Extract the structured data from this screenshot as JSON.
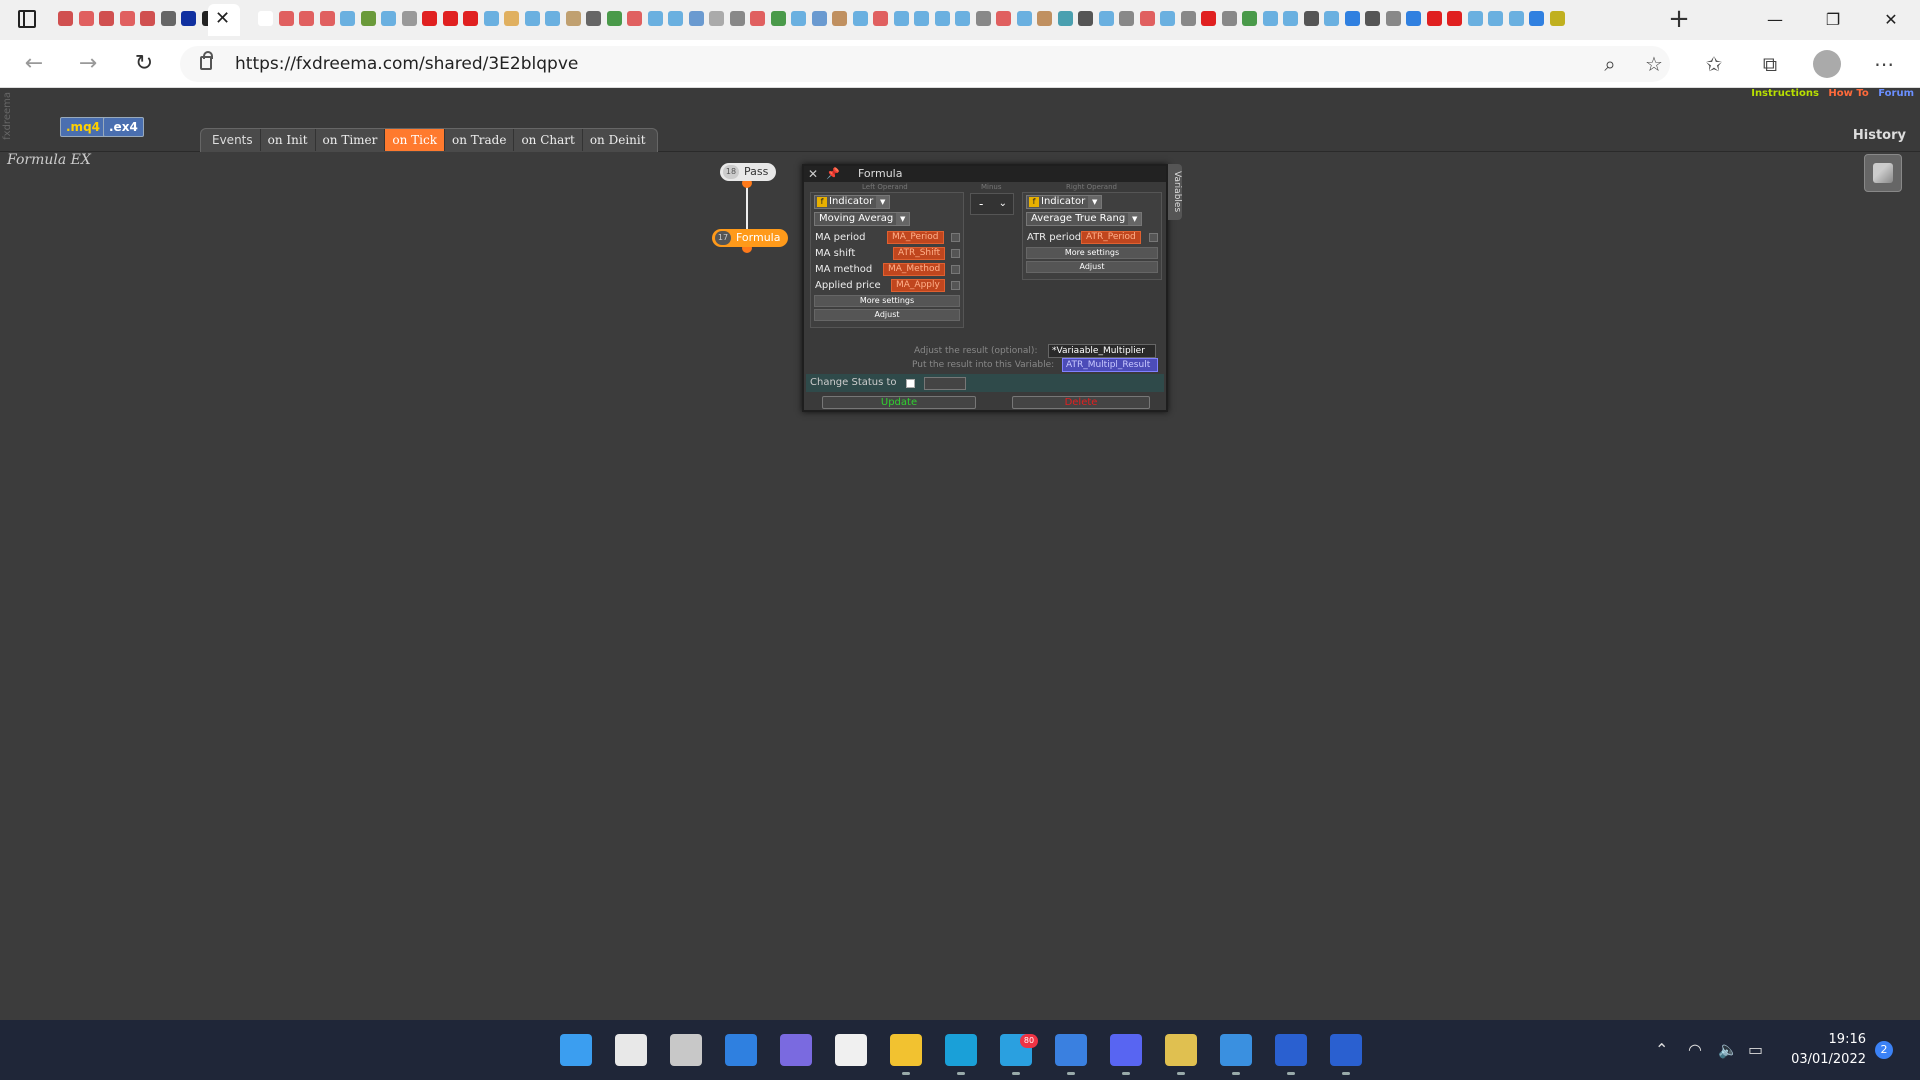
{
  "browser": {
    "url": "https://fxdreema.com/shared/3E2blqpve",
    "active_tab_close": "✕",
    "new_tab": "+",
    "window": {
      "minimize": "—",
      "restore": "❐",
      "close": "✕"
    },
    "nav": {
      "back": "←",
      "forward": "→",
      "reload": "↻"
    },
    "toolbar_icons": [
      "zoom-icon",
      "favorites-add-icon",
      "favorites-icon",
      "collections-icon",
      "more-icon"
    ],
    "tab_favicon_colors": [
      "#d05050",
      "#e06060",
      "#d05050",
      "#e06060",
      "#d05050",
      "#666666",
      "#1030a0",
      "#222222",
      "#ffffff",
      "#e06060",
      "#e06060",
      "#e06060",
      "#6ab0e0",
      "#6a9a3a",
      "#6ab0e0",
      "#999999",
      "#e02020",
      "#e02020",
      "#e02020",
      "#6ab0e0",
      "#e0b060",
      "#6ab0e0",
      "#6ab0e0",
      "#c0a070",
      "#666666",
      "#4a9a4a",
      "#e06060",
      "#6ab0e0",
      "#6ab0e0",
      "#6a9ad0",
      "#aaaaaa",
      "#888888",
      "#e06060",
      "#4a9a4a",
      "#6ab0e0",
      "#6a9ad0",
      "#c09060",
      "#6ab0e0",
      "#e06060",
      "#6ab0e0",
      "#6ab0e0",
      "#6ab0e0",
      "#6ab0e0",
      "#888888",
      "#e06060",
      "#6ab0e0",
      "#c09060",
      "#4aa0b0",
      "#555555",
      "#6ab0e0",
      "#888888",
      "#e06060",
      "#6ab0e0",
      "#888888",
      "#e02020",
      "#888888",
      "#4a9a4a",
      "#6ab0e0",
      "#6ab0e0",
      "#555555",
      "#6ab0e0",
      "#3080e0",
      "#555555",
      "#888888",
      "#3080e0",
      "#e02020",
      "#e02020",
      "#6ab0e0",
      "#6ab0e0",
      "#6ab0e0",
      "#3080e0",
      "#c0b020"
    ]
  },
  "app": {
    "brand_vertical": "fxdreema",
    "links": {
      "instructions": "Instructions",
      "howto": "How To",
      "forum": "Forum"
    },
    "export": {
      "mq4": ".mq4",
      "ex4": ".ex4"
    },
    "events": {
      "label": "Events",
      "tabs": [
        "on Init",
        "on Timer",
        "on Tick",
        "on Trade",
        "on Chart",
        "on Deinit"
      ],
      "active": "on Tick"
    },
    "history": "History",
    "heading": "Formula EX"
  },
  "nodes": {
    "pass": {
      "num": "18",
      "label": "Pass"
    },
    "formula": {
      "num": "17",
      "label": "Formula"
    }
  },
  "formula_panel": {
    "close": "✕",
    "pin": "📌",
    "title": "Formula",
    "variables_tab": "Variables",
    "captions": {
      "left": "Left Operand",
      "operator": "Minus",
      "right": "Right Operand"
    },
    "left": {
      "type": "Indicator",
      "function": "Moving Averag",
      "params": [
        {
          "label": "MA period",
          "value": "MA_Period"
        },
        {
          "label": "MA shift",
          "value": "ATR_Shift"
        },
        {
          "label": "MA method",
          "value": "MA_Method"
        },
        {
          "label": "Applied price",
          "value": "MA_Apply"
        }
      ],
      "more_settings": "More settings",
      "adjust": "Adjust"
    },
    "operator": "-",
    "right": {
      "type": "Indicator",
      "function": "Average True Rang",
      "params": [
        {
          "label": "ATR period",
          "value": "ATR_Period"
        }
      ],
      "more_settings": "More settings",
      "adjust": "Adjust"
    },
    "adjust_result_label": "Adjust the result (optional):",
    "adjust_result_value": "*Variaable_Multiplier",
    "put_result_label": "Put the result into this Variable:",
    "put_result_value": "ATR_Multipl_Result",
    "change_status_label": "Change Status to",
    "update": "Update",
    "delete": "Delete"
  },
  "taskbar": {
    "apps": [
      {
        "name": "start-icon",
        "color": "#3b9ef0",
        "running": false
      },
      {
        "name": "search-icon",
        "color": "#e8e8e8",
        "running": false
      },
      {
        "name": "task-view-icon",
        "color": "#c8c8c8",
        "running": false
      },
      {
        "name": "widgets-icon",
        "color": "#2f80e0",
        "running": false
      },
      {
        "name": "teams-chat-icon",
        "color": "#7a6ae0",
        "running": false
      },
      {
        "name": "pen-app-icon",
        "color": "#f0f0f0",
        "running": false
      },
      {
        "name": "file-explorer-icon",
        "color": "#f2c230",
        "running": true
      },
      {
        "name": "edge-icon",
        "color": "#1aa0d8",
        "running": true
      },
      {
        "name": "telegram-icon",
        "color": "#2aa0e0",
        "running": true
      },
      {
        "name": "mail-icon",
        "color": "#3a80e0",
        "running": true
      },
      {
        "name": "discord-icon",
        "color": "#5865f2",
        "running": true
      },
      {
        "name": "trading-app-icon",
        "color": "#e0c050",
        "running": true
      },
      {
        "name": "notepad-icon",
        "color": "#3a90e0",
        "running": true
      },
      {
        "name": "dev-tool-icon",
        "color": "#2a60d0",
        "running": true
      },
      {
        "name": "dev-tool-2-icon",
        "color": "#2a60d0",
        "running": true
      }
    ],
    "telegram_badge": "80",
    "time": "19:16",
    "date": "03/01/2022",
    "notifications": "2"
  }
}
